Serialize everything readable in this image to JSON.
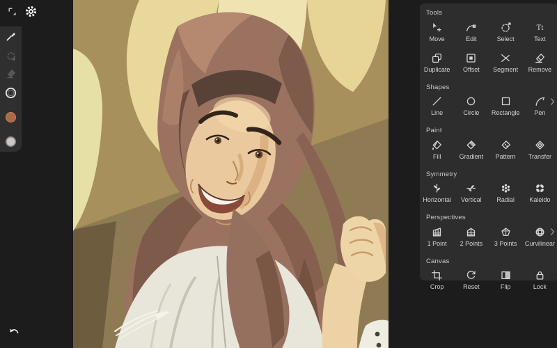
{
  "colors": {
    "app_background": "#1c1c1c",
    "panel_background": "#2d2d2d",
    "toolbar_background": "#2f2f2f",
    "icon_color": "#d6d6d6",
    "label_color": "#d2d2d2",
    "header_color": "#c9c9c9",
    "primary_swatch": "#ad6847",
    "secondary_swatch": "#cbc9c7",
    "artwork_palette": {
      "background_tan": "#a8905c",
      "background_light_swoosh": "#e9d89c",
      "hijab": "#9b7260",
      "hijab_shadow": "#7e5a4b",
      "skin": "#ebc99e",
      "shirt": "#e8e5da"
    }
  },
  "topbar": {
    "icons": [
      {
        "name": "fullscreen-toggle"
      },
      {
        "name": "settings-gear"
      }
    ]
  },
  "left_toolbar": {
    "tools": [
      {
        "name": "brush",
        "state": "active"
      },
      {
        "name": "selection-lasso",
        "state": "dimmed"
      },
      {
        "name": "eraser",
        "state": "dimmed"
      },
      {
        "name": "brush-size-ring",
        "state": "normal"
      },
      {
        "name": "color-swatch-primary",
        "color": "#ad6847"
      },
      {
        "name": "color-swatch-secondary",
        "color": "#cbc9c7"
      }
    ],
    "undo_icon": "undo-arrow"
  },
  "panel": {
    "sections": [
      {
        "title": "Tools",
        "items": [
          {
            "label": "Move",
            "icon": "move"
          },
          {
            "label": "Edit",
            "icon": "edit"
          },
          {
            "label": "Select",
            "icon": "select"
          },
          {
            "label": "Text",
            "icon": "text"
          },
          {
            "label": "Duplicate",
            "icon": "duplicate"
          },
          {
            "label": "Offset",
            "icon": "offset"
          },
          {
            "label": "Segment",
            "icon": "segment"
          },
          {
            "label": "Remove",
            "icon": "remove"
          }
        ]
      },
      {
        "title": "Shapes",
        "has_more_chevron": true,
        "items": [
          {
            "label": "Line",
            "icon": "line"
          },
          {
            "label": "Circle",
            "icon": "circle"
          },
          {
            "label": "Rectangle",
            "icon": "rectangle"
          },
          {
            "label": "Pen",
            "icon": "pen"
          }
        ]
      },
      {
        "title": "Paint",
        "items": [
          {
            "label": "Fill",
            "icon": "fill"
          },
          {
            "label": "Gradient",
            "icon": "gradient"
          },
          {
            "label": "Pattern",
            "icon": "pattern"
          },
          {
            "label": "Transfer",
            "icon": "transfer"
          }
        ]
      },
      {
        "title": "Symmetry",
        "items": [
          {
            "label": "Horizontal",
            "icon": "symmetry-horizontal"
          },
          {
            "label": "Vertical",
            "icon": "symmetry-vertical"
          },
          {
            "label": "Radial",
            "icon": "symmetry-radial"
          },
          {
            "label": "Kaleido",
            "icon": "symmetry-kaleido"
          }
        ]
      },
      {
        "title": "Perspectives",
        "has_more_chevron": true,
        "items": [
          {
            "label": "1 Point",
            "icon": "perspective-1-point"
          },
          {
            "label": "2 Points",
            "icon": "perspective-2-points"
          },
          {
            "label": "3 Points",
            "icon": "perspective-3-points"
          },
          {
            "label": "Curvilinear",
            "icon": "curvilinear"
          }
        ]
      },
      {
        "title": "Canvas",
        "items": [
          {
            "label": "Crop",
            "icon": "crop"
          },
          {
            "label": "Reset",
            "icon": "reset"
          },
          {
            "label": "Flip",
            "icon": "flip"
          },
          {
            "label": "Lock",
            "icon": "lock"
          }
        ]
      }
    ]
  },
  "canvas": {
    "content": "vector-portrait-woman-in-hijab"
  }
}
